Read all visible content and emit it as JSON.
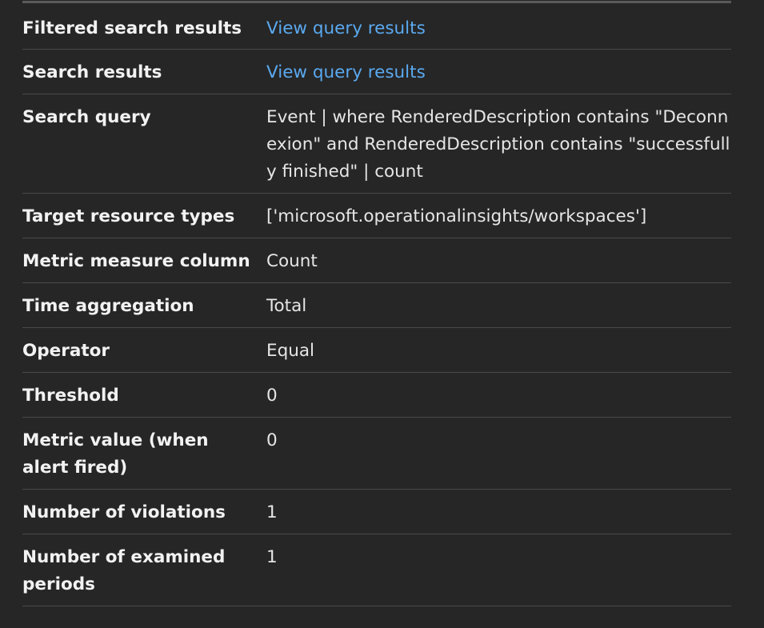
{
  "rows": [
    {
      "label": "Filtered search results",
      "value": "View query results",
      "link": true
    },
    {
      "label": "Search results",
      "value": "View query results",
      "link": true
    },
    {
      "label": "Search query",
      "value": "Event | where RenderedDescription contains \"Deconnexion\" and RenderedDescription contains \"successfully finished\" | count",
      "link": false
    },
    {
      "label": "Target resource types",
      "value": "['microsoft.operationalinsights/workspaces']",
      "link": false
    },
    {
      "label": "Metric measure column",
      "value": "Count",
      "link": false
    },
    {
      "label": "Time aggregation",
      "value": "Total",
      "link": false
    },
    {
      "label": "Operator",
      "value": "Equal",
      "link": false
    },
    {
      "label": "Threshold",
      "value": "0",
      "link": false
    },
    {
      "label": "Metric value (when alert fired)",
      "value": "0",
      "link": false
    },
    {
      "label": "Number of violations",
      "value": "1",
      "link": false
    },
    {
      "label": "Number of examined periods",
      "value": "1",
      "link": false
    }
  ]
}
